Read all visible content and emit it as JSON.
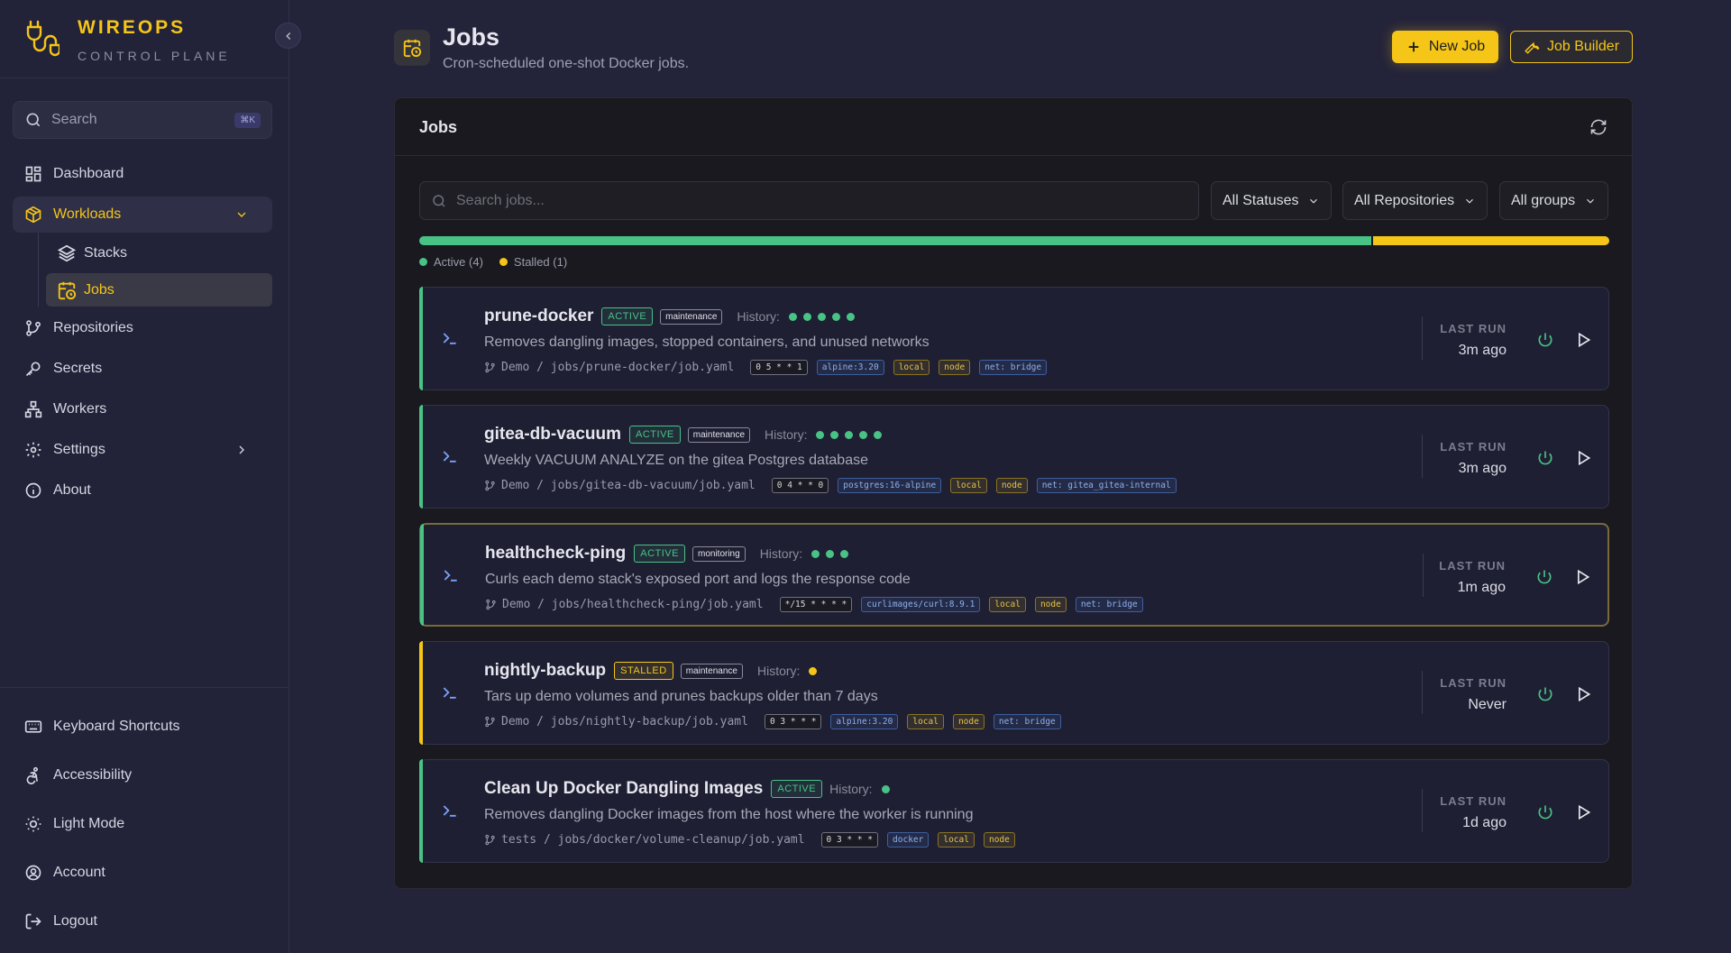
{
  "brand": {
    "name": "WIREOPS",
    "subtitle": "CONTROL PLANE"
  },
  "search": {
    "placeholder": "Search",
    "shortcut": "⌘K"
  },
  "nav": {
    "dashboard": "Dashboard",
    "workloads": "Workloads",
    "stacks": "Stacks",
    "jobs": "Jobs",
    "repositories": "Repositories",
    "secrets": "Secrets",
    "workers": "Workers",
    "settings": "Settings",
    "about": "About"
  },
  "bottom_nav": {
    "shortcuts": "Keyboard Shortcuts",
    "accessibility": "Accessibility",
    "light_mode": "Light Mode",
    "account": "Account",
    "logout": "Logout"
  },
  "header": {
    "title": "Jobs",
    "subtitle": "Cron-scheduled one-shot Docker jobs.",
    "new_job": "New Job",
    "job_builder": "Job Builder"
  },
  "card": {
    "title": "Jobs",
    "search_placeholder": "Search jobs...",
    "filters": {
      "status": "All Statuses",
      "repo": "All Repositories",
      "group": "All groups"
    },
    "status_bar": {
      "active_fraction": 0.8,
      "stalled_fraction": 0.2
    },
    "legend": {
      "active": "Active (4)",
      "stalled": "Stalled (1)"
    }
  },
  "colors": {
    "accent": "#f5c518",
    "active": "#48c285",
    "stalled": "#f5c518"
  },
  "jobs": [
    {
      "name": "prune-docker",
      "status": "ACTIVE",
      "group": "maintenance",
      "history_label": "History:",
      "history": [
        "ok",
        "ok",
        "ok",
        "ok",
        "ok"
      ],
      "description": "Removes dangling images, stopped containers, and unused networks",
      "path": "Demo / jobs/prune-docker/job.yaml",
      "cron": "0 5 * * 1",
      "image": "alpine:3.20",
      "tags": [
        "local",
        "node"
      ],
      "network": "net: bridge",
      "last_run_label": "LAST RUN",
      "last_run": "3m ago"
    },
    {
      "name": "gitea-db-vacuum",
      "status": "ACTIVE",
      "group": "maintenance",
      "history_label": "History:",
      "history": [
        "ok",
        "ok",
        "ok",
        "ok",
        "ok"
      ],
      "description": "Weekly VACUUM ANALYZE on the gitea Postgres database",
      "path": "Demo / jobs/gitea-db-vacuum/job.yaml",
      "cron": "0 4 * * 0",
      "image": "postgres:16-alpine",
      "tags": [
        "local",
        "node"
      ],
      "network": "net: gitea_gitea-internal",
      "last_run_label": "LAST RUN",
      "last_run": "3m ago"
    },
    {
      "name": "healthcheck-ping",
      "status": "ACTIVE",
      "group": "monitoring",
      "history_label": "History:",
      "history": [
        "ok",
        "ok",
        "ok"
      ],
      "description": "Curls each demo stack's exposed port and logs the response code",
      "path": "Demo / jobs/healthcheck-ping/job.yaml",
      "cron": "*/15 * * * *",
      "image": "curlimages/curl:8.9.1",
      "tags": [
        "local",
        "node"
      ],
      "network": "net: bridge",
      "last_run_label": "LAST RUN",
      "last_run": "1m ago"
    },
    {
      "name": "nightly-backup",
      "status": "STALLED",
      "group": "maintenance",
      "history_label": "History:",
      "history": [
        "stalled"
      ],
      "description": "Tars up demo volumes and prunes backups older than 7 days",
      "path": "Demo / jobs/nightly-backup/job.yaml",
      "cron": "0 3 * * *",
      "image": "alpine:3.20",
      "tags": [
        "local",
        "node"
      ],
      "network": "net: bridge",
      "last_run_label": "LAST RUN",
      "last_run": "Never"
    },
    {
      "name": "Clean Up Docker Dangling Images",
      "status": "ACTIVE",
      "group": "",
      "history_label": "History:",
      "history": [
        "ok"
      ],
      "description": "Removes dangling Docker images from the host where the worker is running",
      "path": "tests / jobs/docker/volume-cleanup/job.yaml",
      "cron": "0 3 * * *",
      "image": "docker",
      "tags": [
        "local",
        "node"
      ],
      "network": "",
      "last_run_label": "LAST RUN",
      "last_run": "1d ago"
    }
  ]
}
